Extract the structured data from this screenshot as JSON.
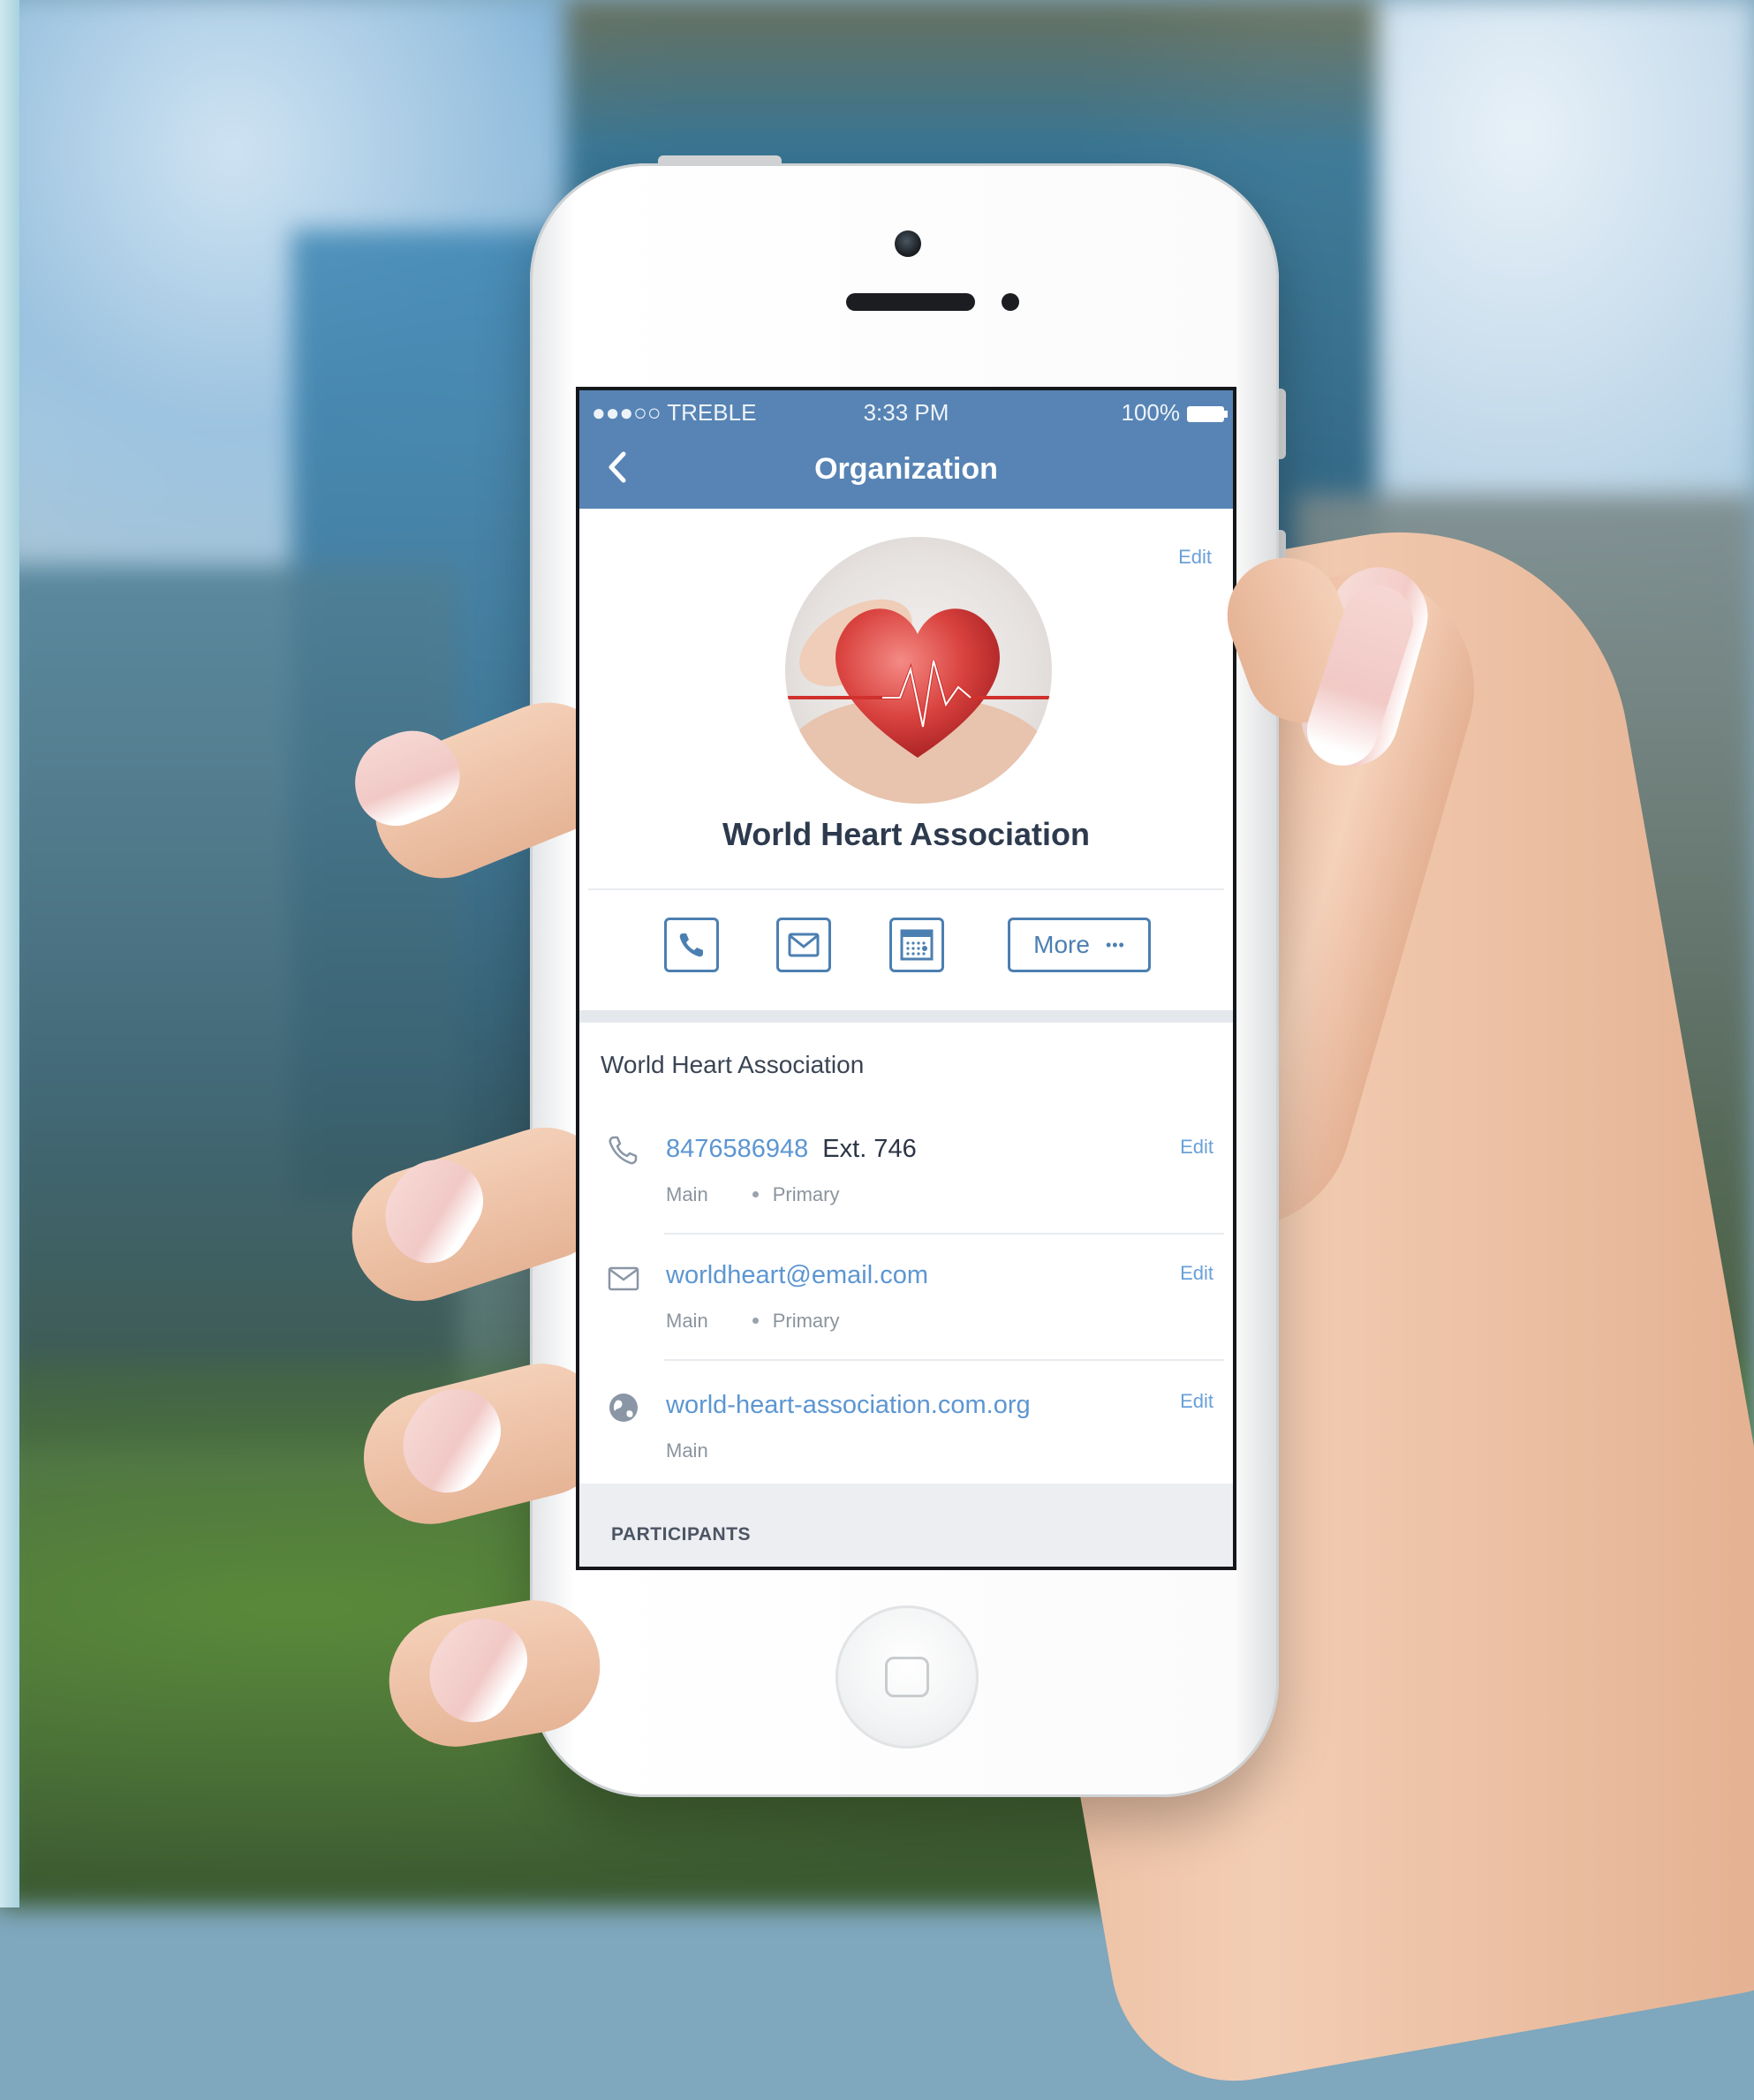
{
  "status_bar": {
    "carrier": "●●●○○ TREBLE",
    "time": "3:33 PM",
    "battery": "100%"
  },
  "nav": {
    "title": "Organization"
  },
  "header": {
    "edit_label": "Edit",
    "org_name": "World Heart Association"
  },
  "actions": {
    "more_label": "More",
    "more_dots": "•••"
  },
  "details": {
    "section_title": "World Heart Association",
    "phone": {
      "number": "8476586948",
      "ext": "Ext. 746",
      "type": "Main",
      "flag": "Primary",
      "edit": "Edit"
    },
    "email": {
      "address": "worldheart@email.com",
      "type": "Main",
      "flag": "Primary",
      "edit": "Edit"
    },
    "website": {
      "url": "world-heart-association.com.org",
      "type": "Main",
      "edit": "Edit"
    }
  },
  "participants": {
    "header": "PARTICIPANTS"
  },
  "colors": {
    "nav_bg": "#5784b5",
    "link": "#5d96d2",
    "accent": "#4c7fb1"
  },
  "icons": [
    "back-chevron-icon",
    "battery-icon",
    "heart-logo-icon",
    "phone-icon",
    "mail-icon",
    "calendar-icon",
    "more-dots-icon",
    "globe-icon"
  ]
}
